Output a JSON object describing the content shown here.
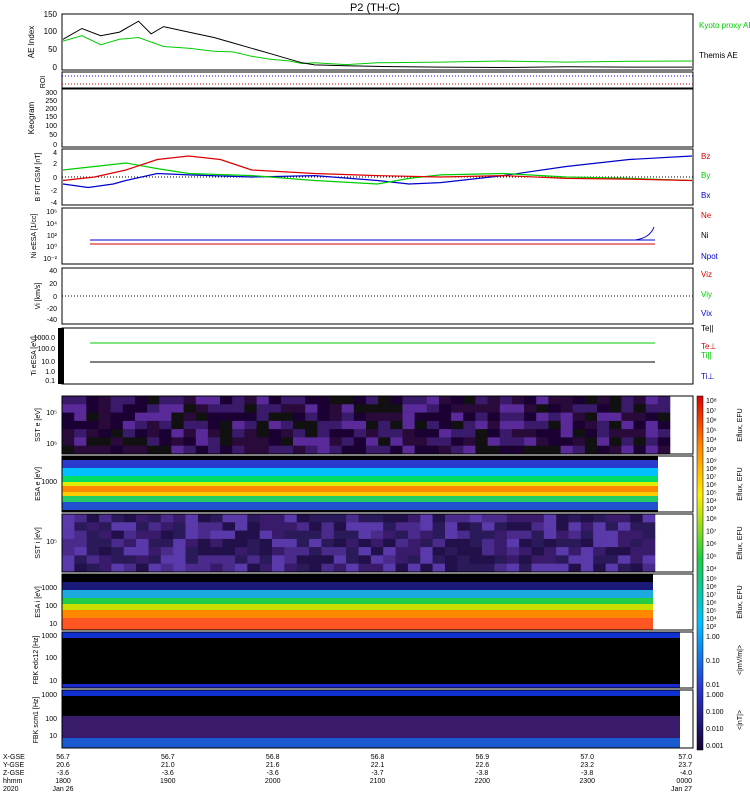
{
  "title": "P2 (TH-C)",
  "panels": {
    "ae": {
      "ylabel": "AE Index",
      "yticks": [
        "0",
        "50",
        "100",
        "150"
      ],
      "legend": [
        {
          "text": "Kyoto proxy AE",
          "color": "#00cc00"
        },
        {
          "text": "Themis AE",
          "color": "#000000"
        }
      ],
      "series": {
        "kyoto": {
          "color": "#00cc00",
          "x": [
            0,
            0.03,
            0.06,
            0.09,
            0.12,
            0.16,
            0.2,
            0.24,
            0.27,
            0.3,
            0.33,
            0.36,
            0.38,
            0.4,
            0.45,
            0.5,
            0.6,
            0.7,
            0.8,
            0.9,
            1.0
          ],
          "y": [
            80,
            95,
            70,
            85,
            90,
            65,
            60,
            52,
            50,
            38,
            30,
            25,
            18,
            20,
            15,
            20,
            22,
            25,
            22,
            24,
            25
          ]
        },
        "themis": {
          "color": "#000000",
          "x": [
            0,
            0.03,
            0.06,
            0.09,
            0.12,
            0.14,
            0.16,
            0.2,
            0.24,
            0.27,
            0.3,
            0.33,
            0.36,
            0.38,
            0.4,
            0.45,
            0.5,
            0.6,
            0.7,
            0.8,
            0.9,
            1.0
          ],
          "y": [
            85,
            115,
            95,
            105,
            135,
            100,
            120,
            105,
            90,
            75,
            60,
            45,
            30,
            20,
            14,
            12,
            10,
            8,
            7,
            9,
            8,
            8
          ]
        }
      }
    },
    "roi": {
      "ylabel": "ROI"
    },
    "keogram": {
      "ylabel": "Keogram",
      "yticks": [
        "0",
        "50",
        "100",
        "150",
        "200",
        "250",
        "300"
      ]
    },
    "bfield": {
      "ylabel": "B FIT GSM [nT]",
      "yticks": [
        "-4",
        "-2",
        "0",
        "2",
        "4"
      ],
      "legend": [
        {
          "text": "Bz",
          "color": "#dd0000"
        },
        {
          "text": "By",
          "color": "#00cc00"
        },
        {
          "text": "Bx",
          "color": "#0000cc"
        }
      ],
      "series": {
        "bx": {
          "color": "#0000cc",
          "x": [
            0,
            0.04,
            0.08,
            0.1,
            0.15,
            0.2,
            0.3,
            0.4,
            0.5,
            0.55,
            0.6,
            0.65,
            0.7,
            0.8,
            0.9,
            1.0
          ],
          "y": [
            -1,
            -1.5,
            -1,
            -0.5,
            0.5,
            0.3,
            0,
            0.2,
            -0.5,
            -1,
            -0.8,
            -0.3,
            0.2,
            1.5,
            2.5,
            3
          ]
        },
        "by": {
          "color": "#00cc00",
          "x": [
            0,
            0.05,
            0.1,
            0.15,
            0.2,
            0.3,
            0.4,
            0.5,
            0.55,
            0.6,
            0.7,
            0.8,
            0.9,
            1.0
          ],
          "y": [
            1,
            1.5,
            2,
            1.2,
            0.5,
            0.2,
            -0.5,
            -1,
            -0.2,
            0.3,
            0.5,
            0,
            -0.2,
            -0.5
          ]
        },
        "bz": {
          "color": "#dd0000",
          "x": [
            0,
            0.05,
            0.1,
            0.15,
            0.2,
            0.25,
            0.3,
            0.4,
            0.5,
            0.6,
            0.7,
            0.8,
            0.9,
            1.0
          ],
          "y": [
            -0.5,
            0,
            1,
            2.5,
            3,
            2.5,
            1,
            0.5,
            0.2,
            0,
            0.2,
            -0.2,
            -0.3,
            -0.5
          ]
        }
      }
    },
    "density": {
      "ylabel": "Ni eESA [1/cc]",
      "yticks": [
        "10⁻²",
        "10⁰",
        "10²",
        "10⁴",
        "10⁶"
      ],
      "legend": [
        {
          "text": "Ne",
          "color": "#dd0000"
        },
        {
          "text": "Ni",
          "color": "#000000"
        },
        {
          "text": "Npot",
          "color": "#0000cc"
        }
      ]
    },
    "velocity": {
      "ylabel": "Vi [km/s]",
      "yticks": [
        "-40",
        "-20",
        "0",
        "20",
        "40"
      ],
      "legend": [
        {
          "text": "Viz",
          "color": "#dd0000"
        },
        {
          "text": "Viy",
          "color": "#00cc00"
        },
        {
          "text": "Vix",
          "color": "#0000cc"
        }
      ]
    },
    "temperature": {
      "ylabel": "Ti eESA [eV]",
      "yticks": [
        "0.1",
        "1.0",
        "10.0",
        "100.0",
        "1000.0"
      ],
      "legend": [
        {
          "text": "Te||",
          "color": "#000000"
        },
        {
          "text": "Te⊥",
          "color": "#dd0000"
        },
        {
          "text": "Ti||",
          "color": "#00cc00"
        },
        {
          "text": "Ti⊥",
          "color": "#0000cc"
        }
      ]
    },
    "sst_e": {
      "ylabel": "SST e [eV]",
      "yticks": [
        "10⁵",
        "10⁶"
      ]
    },
    "esa_e": {
      "ylabel": "ESA e [eV]",
      "yticks": [
        "1000"
      ]
    },
    "sst_i": {
      "ylabel": "SST i [eV]",
      "yticks": [
        "10⁵",
        "10⁶"
      ]
    },
    "esa_i": {
      "ylabel": "ESA i [eV]",
      "yticks": [
        "10",
        "100",
        "1000"
      ]
    },
    "fbk_e": {
      "ylabel": "FBK edc12 [Hz]",
      "yticks": [
        "10",
        "100",
        "1000"
      ]
    },
    "fbk_b": {
      "ylabel": "FBK scm1 [Hz]",
      "yticks": [
        "10",
        "100",
        "1000"
      ]
    }
  },
  "colorbars": {
    "eflux1": {
      "label": "Eflux, EFU",
      "ticks": [
        "10⁸",
        "10⁷",
        "10⁶",
        "10⁵",
        "10⁴",
        "10³"
      ]
    },
    "eflux2": {
      "label": "Eflux, EFU",
      "ticks": [
        "10⁹",
        "10⁸",
        "10⁷",
        "10⁶",
        "10⁵",
        "10⁴",
        "10³"
      ]
    },
    "eflux3": {
      "label": "Eflux, EFU",
      "ticks": [
        "10⁸",
        "10⁷",
        "10⁶",
        "10⁵",
        "10⁴"
      ]
    },
    "eflux4": {
      "label": "Eflux, EFU",
      "ticks": [
        "10⁹",
        "10⁸",
        "10⁷",
        "10⁶",
        "10⁵",
        "10⁴",
        "10³"
      ]
    },
    "fbk1": {
      "label": "<|mV/m|>",
      "ticks": [
        "1.00",
        "0.10",
        "0.01"
      ]
    },
    "fbk2": {
      "label": "<|nT|>",
      "ticks": [
        "1.000",
        "0.100",
        "0.010",
        "0.001"
      ]
    }
  },
  "x_axis": {
    "row_labels": [
      "X-GSE",
      "Y-GSE",
      "Z-GSE",
      "hhmm",
      "2020"
    ],
    "columns": [
      [
        "56.7",
        "20.6",
        "-3.6",
        "1800",
        "Jan 26"
      ],
      [
        "56.7",
        "21.0",
        "-3.6",
        "1900",
        ""
      ],
      [
        "56.8",
        "21.6",
        "-3.6",
        "2000",
        ""
      ],
      [
        "56.8",
        "22.1",
        "-3.7",
        "2100",
        ""
      ],
      [
        "56.9",
        "22.6",
        "-3.8",
        "2200",
        ""
      ],
      [
        "57.0",
        "23.2",
        "-3.8",
        "2300",
        ""
      ],
      [
        "57.0",
        "23.7",
        "-4.0",
        "0000",
        "Jan 27"
      ]
    ]
  }
}
